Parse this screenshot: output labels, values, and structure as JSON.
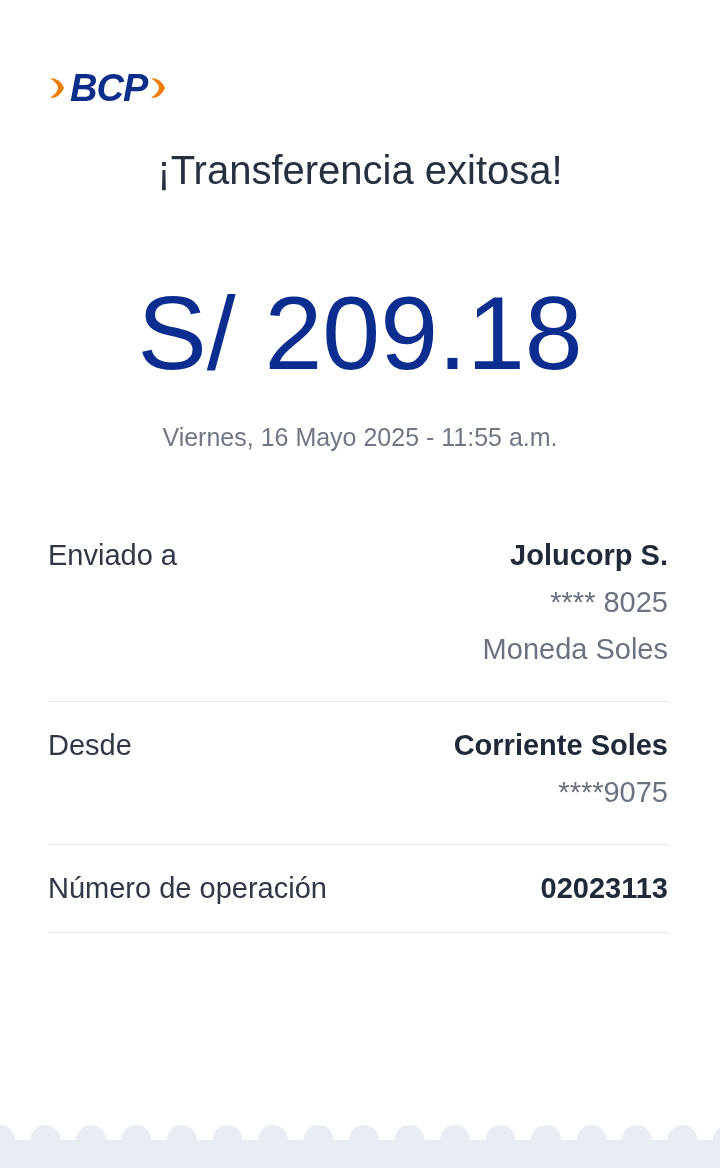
{
  "logo": {
    "text": "BCP"
  },
  "title": "¡Transferencia exitosa!",
  "amount": "S/ 209.18",
  "date": "Viernes, 16 Mayo 2025 - 11:55 a.m.",
  "details": [
    {
      "label": "Enviado a",
      "values": [
        {
          "text": "Jolucorp S.",
          "kind": "primary"
        },
        {
          "text": "**** 8025",
          "kind": "secondary"
        },
        {
          "text": "Moneda Soles",
          "kind": "secondary"
        }
      ]
    },
    {
      "label": "Desde",
      "values": [
        {
          "text": "Corriente Soles",
          "kind": "primary"
        },
        {
          "text": "****9075",
          "kind": "secondary"
        }
      ]
    },
    {
      "label": "Número de operación",
      "values": [
        {
          "text": "02023113",
          "kind": "primary"
        }
      ]
    }
  ]
}
